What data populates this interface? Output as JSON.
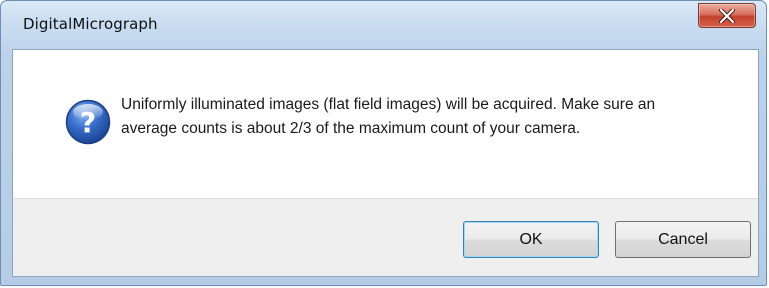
{
  "window": {
    "title": "DigitalMicrograph",
    "close_icon": "close-x-icon"
  },
  "dialog": {
    "icon": "question-icon",
    "icon_glyph": "?",
    "message": "Uniformly illuminated images (flat field images) will be acquired. Make sure an average counts is about 2/3 of the maximum count of your camera."
  },
  "buttons": {
    "ok_label": "OK",
    "cancel_label": "Cancel"
  },
  "colors": {
    "titlebar": "#c9dcf1",
    "close_button": "#c4412d",
    "icon_blue": "#2a5fb8",
    "default_button_border": "#3c7fb1"
  }
}
